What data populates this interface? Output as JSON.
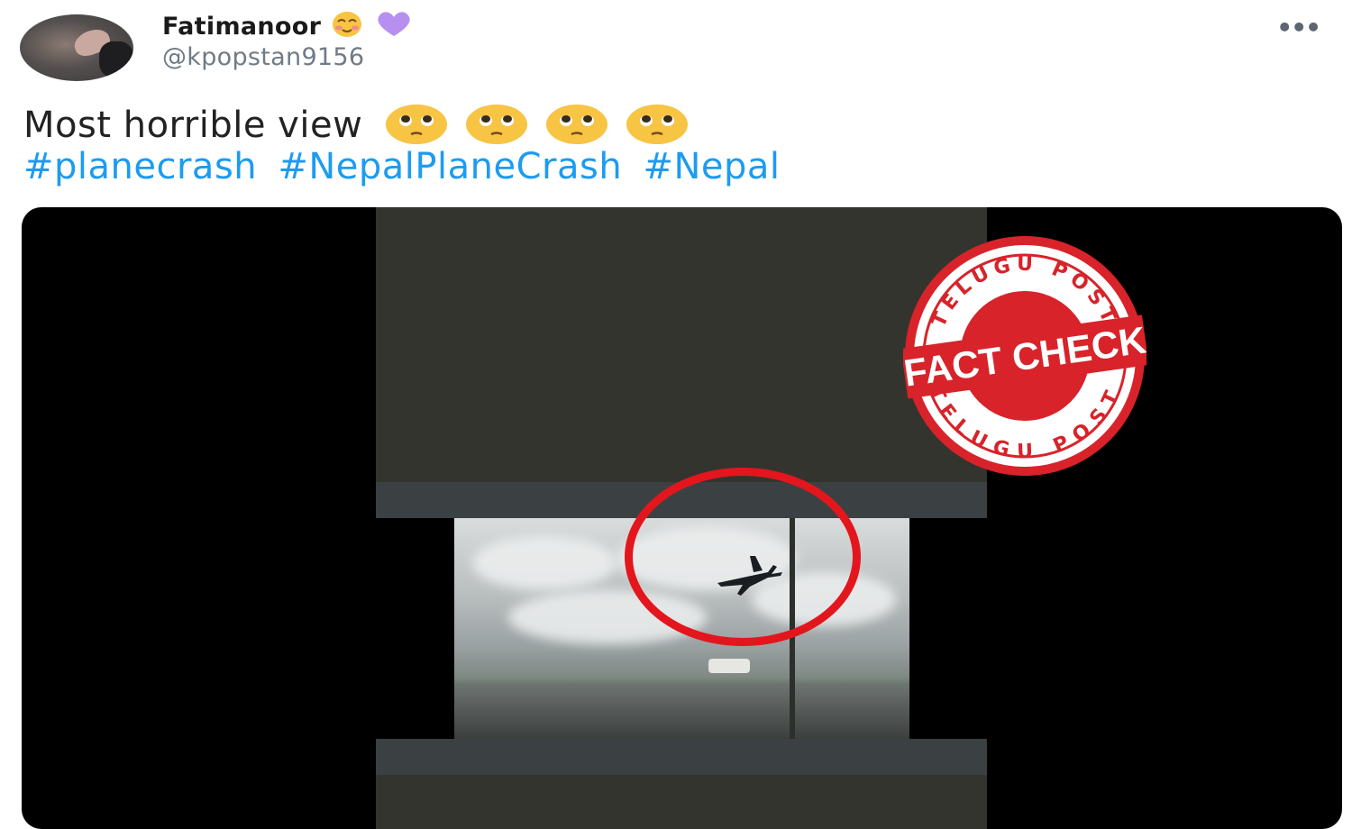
{
  "user": {
    "display_name": "Fatimanoor",
    "name_emojis": [
      "smiling-face-icon",
      "purple-heart-icon"
    ],
    "handle": "@kpopstan9156"
  },
  "more_menu_label": "•••",
  "tweet": {
    "text": "Most horrible view",
    "emojis": [
      "pleading-face-icon",
      "pleading-face-icon",
      "pleading-face-icon",
      "pleading-face-icon"
    ],
    "hashtags": [
      "#planecrash",
      "#NepalPlaneCrash",
      "#Nepal"
    ]
  },
  "stamp": {
    "top_text": "TELUGU POST",
    "center_text": "FACT CHECK",
    "bottom_text": "TELUGU POST",
    "color": "#d8232a"
  },
  "colors": {
    "hashtag": "#1d9bf0",
    "highlight_circle": "#e3161d"
  }
}
